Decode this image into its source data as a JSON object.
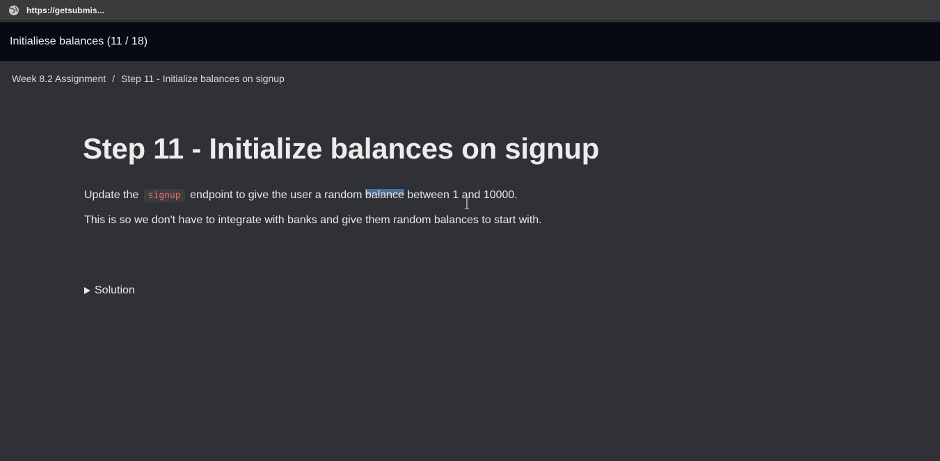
{
  "browser": {
    "url": "https://getsubmis..."
  },
  "header": {
    "title": "Initialiese balances (11 / 18)"
  },
  "breadcrumb": {
    "items": [
      "Week 8.2 Assignment",
      "Step 11 - Initialize balances on signup"
    ],
    "separator": "/"
  },
  "content": {
    "heading": "Step 11 - Initialize balances on signup",
    "para1": {
      "before": "Update the",
      "code": "signup",
      "middle": "endpoint to give the user a random",
      "highlight": "balance",
      "after": "between 1 and 10000."
    },
    "para2": "This is so we don't have to integrate with banks and give them random balances to start with.",
    "solution_label": "Solution"
  },
  "colors": {
    "background": "#2f3136",
    "header_bg": "#070a12",
    "code_text": "#e5736a"
  }
}
